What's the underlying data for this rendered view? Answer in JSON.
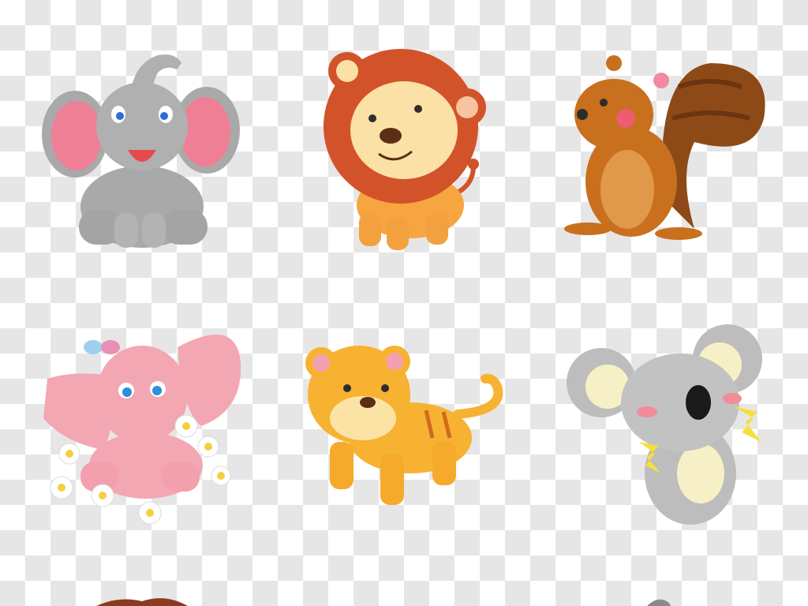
{
  "background": {
    "pattern": "transparency-checkerboard",
    "light": "#ffffff",
    "dark": "#e6e6e6"
  },
  "animals": [
    {
      "name": "gray-elephant",
      "colors": {
        "body": "#a9a9a9",
        "ear_inner": "#ef7f94",
        "mouth": "#e8494f"
      }
    },
    {
      "name": "lion",
      "colors": {
        "mane": "#d2532a",
        "face": "#fbe1a6",
        "body": "#f6a540"
      }
    },
    {
      "name": "squirrel",
      "colors": {
        "body": "#c8701e",
        "tail": "#8d4a17",
        "belly": "#e0994a",
        "cheek": "#ec5d6f"
      }
    },
    {
      "name": "pink-elephant",
      "colors": {
        "body": "#f3a7b3",
        "flowers": "#ffffff",
        "flower_center": "#f4d03f",
        "butterfly": "#9ed0ec"
      }
    },
    {
      "name": "tiger",
      "colors": {
        "body": "#f7b231",
        "stripes": "#d2691e",
        "face": "#fbe3a6"
      }
    },
    {
      "name": "koala",
      "colors": {
        "body": "#bdbdbd",
        "ear_inner": "#f7f0c6",
        "nose": "#1a1a1a",
        "cheek": "#f28c9a",
        "sparkle": "#f4e03a"
      }
    }
  ]
}
